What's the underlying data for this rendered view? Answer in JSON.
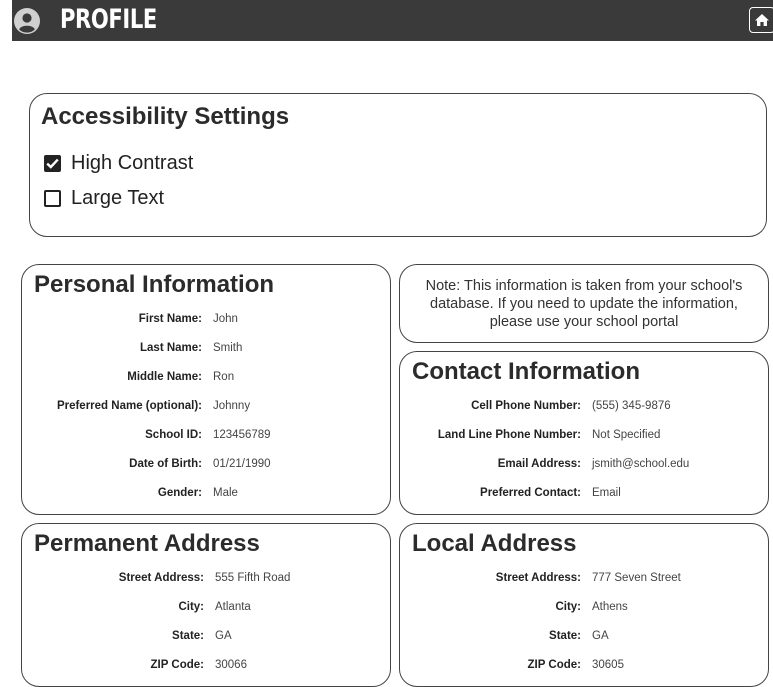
{
  "header": {
    "title": "PROFILE"
  },
  "accessibility": {
    "title": "Accessibility Settings",
    "options": [
      {
        "label": "High Contrast",
        "checked": true
      },
      {
        "label": "Large Text",
        "checked": false
      }
    ]
  },
  "personal": {
    "title": "Personal Information",
    "fields": [
      {
        "label": "First Name:",
        "value": "John"
      },
      {
        "label": "Last Name:",
        "value": "Smith"
      },
      {
        "label": "Middle Name:",
        "value": "Ron"
      },
      {
        "label": "Preferred Name (optional):",
        "value": "Johnny"
      },
      {
        "label": "School ID:",
        "value": "123456789"
      },
      {
        "label": "Date of Birth:",
        "value": "01/21/1990"
      },
      {
        "label": "Gender:",
        "value": "Male"
      }
    ]
  },
  "note": {
    "text": "Note: This information is taken from your school's database. If you need to update the information, please use your school portal"
  },
  "contact": {
    "title": "Contact Information",
    "fields": [
      {
        "label": "Cell Phone Number:",
        "value": "(555) 345-9876"
      },
      {
        "label": "Land Line Phone Number:",
        "value": "Not Specified"
      },
      {
        "label": "Email Address:",
        "value": "jsmith@school.edu"
      },
      {
        "label": "Preferred Contact:",
        "value": "Email"
      }
    ]
  },
  "permanent": {
    "title": "Permanent Address",
    "fields": [
      {
        "label": "Street Address:",
        "value": "555 Fifth Road"
      },
      {
        "label": "City:",
        "value": "Atlanta"
      },
      {
        "label": "State:",
        "value": "GA"
      },
      {
        "label": "ZIP Code:",
        "value": "30066"
      }
    ]
  },
  "local": {
    "title": "Local Address",
    "fields": [
      {
        "label": "Street Address:",
        "value": "777 Seven Street"
      },
      {
        "label": "City:",
        "value": "Athens"
      },
      {
        "label": "State:",
        "value": "GA"
      },
      {
        "label": "ZIP Code:",
        "value": "30605"
      }
    ]
  }
}
